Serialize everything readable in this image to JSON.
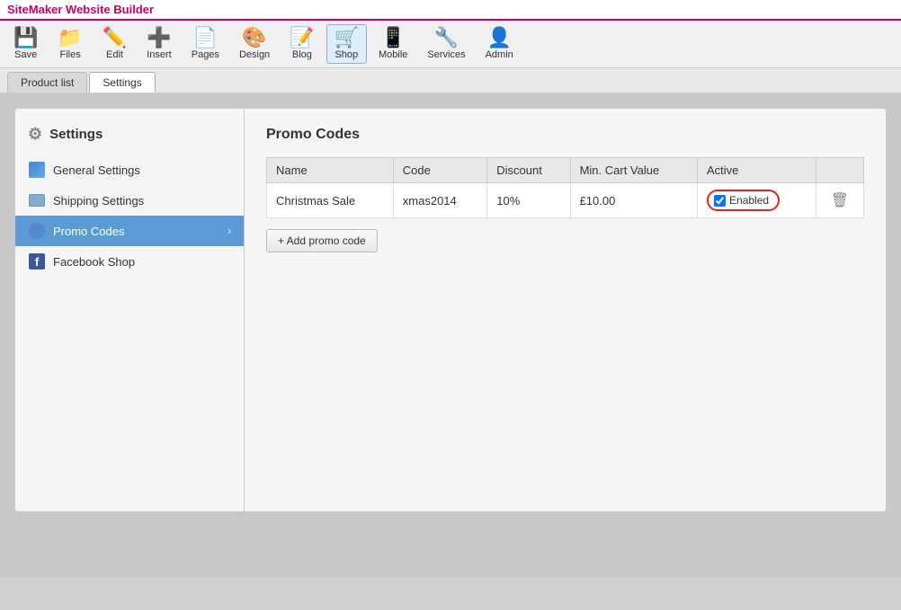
{
  "app": {
    "title": "SiteMaker Website Builder"
  },
  "toolbar": {
    "buttons": [
      {
        "id": "save",
        "label": "Save",
        "icon": "💾"
      },
      {
        "id": "files",
        "label": "Files",
        "icon": "📁"
      },
      {
        "id": "edit",
        "label": "Edit",
        "icon": "✏️"
      },
      {
        "id": "insert",
        "label": "Insert",
        "icon": "➕"
      },
      {
        "id": "pages",
        "label": "Pages",
        "icon": "📄"
      },
      {
        "id": "design",
        "label": "Design",
        "icon": "🎨"
      },
      {
        "id": "blog",
        "label": "Blog",
        "icon": "📝"
      },
      {
        "id": "shop",
        "label": "Shop",
        "icon": "🛒"
      },
      {
        "id": "mobile",
        "label": "Mobile",
        "icon": "📱"
      },
      {
        "id": "services",
        "label": "Services",
        "icon": "🔧"
      },
      {
        "id": "admin",
        "label": "Admin",
        "icon": "👤"
      }
    ]
  },
  "tabs": [
    {
      "id": "product-list",
      "label": "Product list",
      "active": false
    },
    {
      "id": "settings",
      "label": "Settings",
      "active": true
    }
  ],
  "sidebar": {
    "title": "Settings",
    "items": [
      {
        "id": "general",
        "label": "General Settings",
        "icon": "general",
        "active": false
      },
      {
        "id": "shipping",
        "label": "Shipping Settings",
        "icon": "shipping",
        "active": false
      },
      {
        "id": "promo",
        "label": "Promo Codes",
        "icon": "promo",
        "active": true
      },
      {
        "id": "facebook",
        "label": "Facebook Shop",
        "icon": "facebook",
        "active": false
      }
    ]
  },
  "content": {
    "title": "Promo Codes",
    "table": {
      "headers": [
        "Name",
        "Code",
        "Discount",
        "Min. Cart Value",
        "Active"
      ],
      "rows": [
        {
          "name": "Christmas Sale",
          "code": "xmas2014",
          "discount": "10%",
          "min_cart": "£10.00",
          "active": "Enabled"
        }
      ]
    },
    "add_button": "+ Add promo code"
  }
}
